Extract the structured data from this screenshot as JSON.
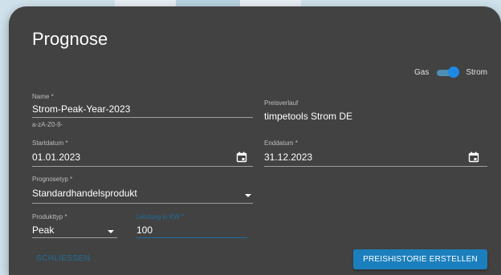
{
  "dialog": {
    "title": "Prognose",
    "toggle": {
      "left_label": "Gas",
      "right_label": "Strom",
      "selected": "Strom"
    },
    "name": {
      "label": "Name *",
      "value": "Strom-Peak-Year-2023",
      "hint": "a-zA-Z0-9-"
    },
    "preisverlauf": {
      "label": "Preisverlauf",
      "value": "timpetools Strom DE"
    },
    "startdatum": {
      "label": "Startdatum *",
      "value": "01.01.2023",
      "icon": "calendar-icon"
    },
    "enddatum": {
      "label": "Enddatum *",
      "value": "31.12.2023",
      "icon": "calendar-icon"
    },
    "prognosetyp": {
      "label": "Prognosetyp *",
      "value": "Standardhandelsprodukt",
      "icon": "dropdown-arrow-icon"
    },
    "produkttyp": {
      "label": "Produkttyp *",
      "value": "Peak",
      "icon": "dropdown-arrow-icon"
    },
    "leistung": {
      "label": "Leistung in KW *",
      "value": "100"
    },
    "buttons": {
      "close": "SCHLIESSEN",
      "create": "PREISHISTORIE ERSTELLEN"
    }
  },
  "colors": {
    "dialog_bg": "#424242",
    "accent": "#1b7fbd",
    "focus_label": "#1e6fa3",
    "background": "#cfe1ea"
  }
}
